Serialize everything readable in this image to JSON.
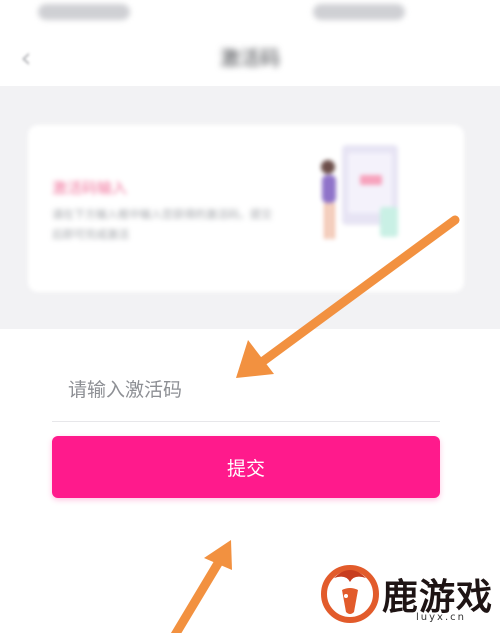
{
  "status_bar": {},
  "header": {
    "back_icon": "chevron-left-icon",
    "title": "激活码"
  },
  "banner": {
    "heading": "激活码输入",
    "description": "请在下方输入框中输入您获得的激活码，提交后即可完成激活"
  },
  "form": {
    "code_placeholder": "请输入激活码",
    "code_value": "",
    "submit_label": "提交"
  },
  "watermark": {
    "name": "鹿游戏",
    "url": "luyx.cn"
  },
  "colors": {
    "accent": "#ff1a8c",
    "arrow": "#f29140",
    "page_background": "#f2f2f4"
  }
}
